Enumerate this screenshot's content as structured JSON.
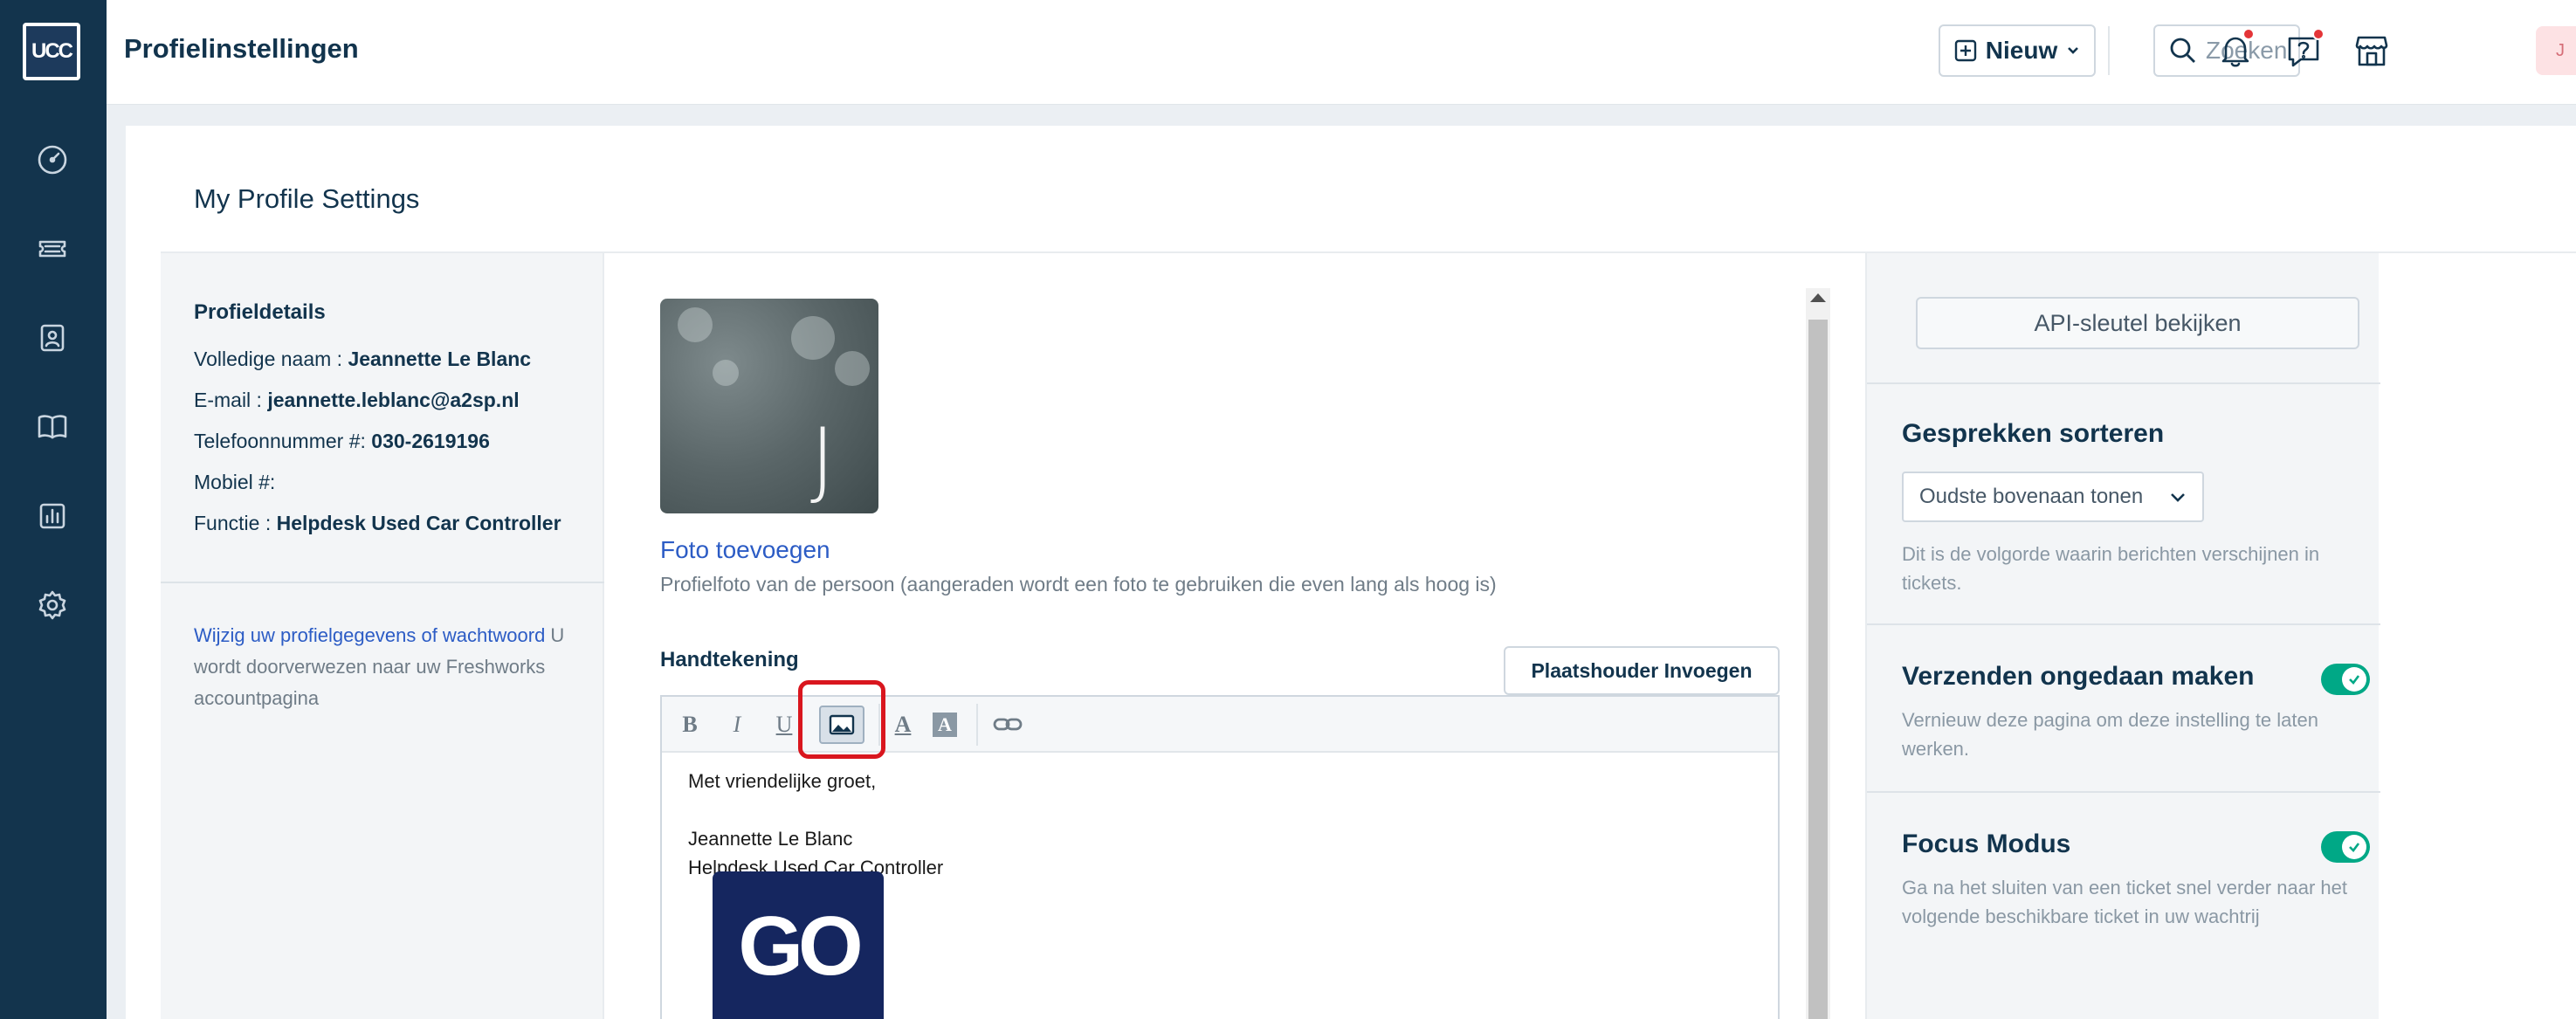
{
  "topbar": {
    "title": "Profielinstellingen",
    "new_label": "Nieuw",
    "search_placeholder": "Zoeken",
    "avatar_initial": "J"
  },
  "card": {
    "title": "My Profile Settings"
  },
  "left": {
    "heading": "Profieldetails",
    "details": [
      {
        "label": "Volledige naam : ",
        "value": "Jeannette Le Blanc"
      },
      {
        "label": "E-mail : ",
        "value": "jeannette.leblanc@a2sp.nl"
      },
      {
        "label": "Telefoonnummer #: ",
        "value": "030-2619196"
      },
      {
        "label": "Mobiel #:",
        "value": ""
      },
      {
        "label": "Functie : ",
        "value": "Helpdesk Used Car Controller"
      }
    ],
    "note_link": "Wijzig uw profielgegevens of wachtwoord",
    "note_text": " U wordt doorverwezen naar uw Freshworks accountpagina"
  },
  "middle": {
    "photo_initial": "J",
    "photo_link": "Foto toevoegen",
    "photo_help": "Profielfoto van de persoon (aangeraden wordt een foto te gebruiken die even lang als hoog is)",
    "signature_label": "Handtekening",
    "placeholder_button": "Plaatshouder Invoegen",
    "toolbar": {
      "bold": "B",
      "italic": "I",
      "underline": "U",
      "font_color": "A",
      "bg_color": "A"
    },
    "signature_lines": [
      "Met vriendelijke groet,",
      "Jeannette Le Blanc",
      "Helpdesk Used Car Controller"
    ],
    "logo_text": "GO"
  },
  "right": {
    "api_button": "API-sleutel bekijken",
    "sort_heading": "Gesprekken sorteren",
    "sort_selected": "Oudste bovenaan tonen",
    "sort_help": "Dit is de volgorde waarin berichten verschijnen in tickets.",
    "undo_heading": "Verzenden ongedaan maken",
    "undo_help": "Vernieuw deze pagina om deze instelling te laten werken.",
    "focus_heading": "Focus Modus",
    "focus_help": "Ga na het sluiten van een ticket snel verder naar het volgende beschikbare ticket in uw wachtrij"
  },
  "colors": {
    "sidebar": "#13344d",
    "accent_link": "#2c5cc5",
    "toggle_on": "#00a886",
    "highlight": "#d9161e"
  }
}
